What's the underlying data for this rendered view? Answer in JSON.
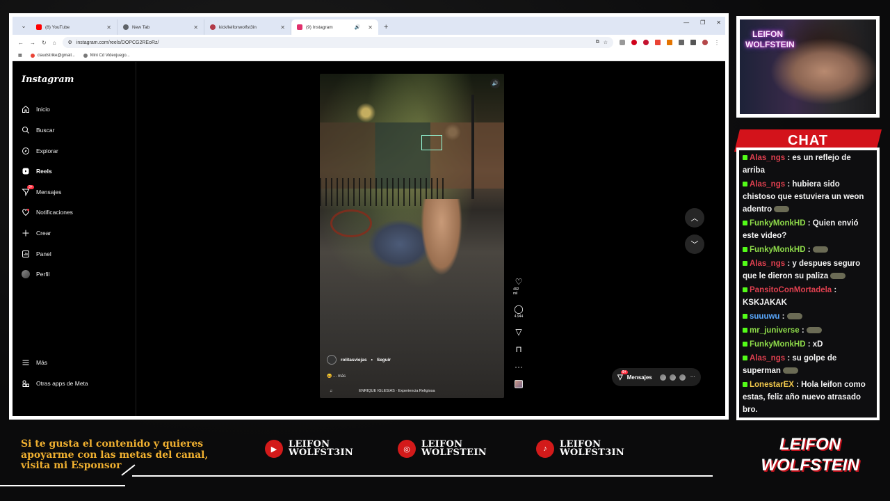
{
  "browser": {
    "tabs": [
      {
        "label": "(8) YouTube",
        "favicon_color": "#ff0000"
      },
      {
        "label": "New Tab",
        "favicon_color": "#5f6368"
      },
      {
        "label": "kick/leifonwolfst3in",
        "favicon_color": "#b23a48"
      },
      {
        "label": "(9) Instagram",
        "favicon_color": "#e1306c"
      }
    ],
    "url": "instagram.com/reels/DOPCG2REoRz/",
    "bookmarks": [
      "claudstrike@gmail...",
      "Mini Cd Videojuego..."
    ]
  },
  "instagram": {
    "logo": "Instagram",
    "nav": [
      {
        "label": "Inicio",
        "icon": "home-icon"
      },
      {
        "label": "Buscar",
        "icon": "search-icon"
      },
      {
        "label": "Explorar",
        "icon": "compass-icon"
      },
      {
        "label": "Reels",
        "icon": "reels-icon"
      },
      {
        "label": "Mensajes",
        "icon": "messenger-icon",
        "badge": "9+"
      },
      {
        "label": "Notificaciones",
        "icon": "heart-icon"
      },
      {
        "label": "Crear",
        "icon": "plus-icon"
      },
      {
        "label": "Panel",
        "icon": "dashboard-icon"
      },
      {
        "label": "Perfil",
        "icon": "avatar-icon"
      },
      {
        "label": "Más",
        "icon": "menu-icon"
      },
      {
        "label": "Otras apps de Meta",
        "icon": "meta-apps-icon"
      }
    ],
    "reel": {
      "username": "rolitasviejas",
      "follow": "Seguir",
      "caption": "😄 ... más",
      "music": "ENRIQUE IGLESIAS · Experiencia Religiosa",
      "likes": "492 mil",
      "comments": "4.944"
    },
    "messages_pill": {
      "label": "Mensajes",
      "badge": "9+"
    }
  },
  "stream": {
    "neon_sign": "LEIFON WOLFSTEIN",
    "chat_title": "CHAT",
    "chat": [
      {
        "user": "Alas_ngs",
        "color": "#e0404f",
        "text": ": es un reflejo de arriba"
      },
      {
        "user": "Alas_ngs",
        "color": "#e0404f",
        "text": ": hubiera sido chistoso que estuviera un weon adentro",
        "emote": true
      },
      {
        "user": "FunkyMonkHD",
        "color": "#8fdc4a",
        "text": ": Quien envió este video?"
      },
      {
        "user": "FunkyMonkHD",
        "color": "#8fdc4a",
        "text": ":",
        "emote": true
      },
      {
        "user": "Alas_ngs",
        "color": "#e0404f",
        "text": ": y despues seguro que le dieron su paliza",
        "emote": true
      },
      {
        "user": "PansitoConMortadela",
        "color": "#e0404f",
        "text": ": KSKJAKAK"
      },
      {
        "user": "suuuwu",
        "color": "#5aa9ff",
        "text": ":",
        "emote": true
      },
      {
        "user": "mr_juniverse",
        "color": "#8fdc4a",
        "text": ":",
        "emote": true
      },
      {
        "user": "FunkyMonkHD",
        "color": "#8fdc4a",
        "text": ": xD"
      },
      {
        "user": "Alas_ngs",
        "color": "#e0404f",
        "text": ": su golpe de superman",
        "emote": true
      },
      {
        "user": "LonestarEX",
        "color": "#f2c94c",
        "text": ": Hola leifon como estas, feliz año nuevo atrasado bro."
      }
    ],
    "support_text": "Si te gusta el contenido y quieres apoyarme con las metas del canal, visita mi Esponsor",
    "socials": [
      {
        "icon": "youtube-icon",
        "line1": "LEIFON",
        "line2": "WOLFST3IN"
      },
      {
        "icon": "instagram-icon",
        "line1": "LEIFON",
        "line2": "WOLFSTEIN"
      },
      {
        "icon": "tiktok-icon",
        "line1": "LEIFON",
        "line2": "WOLFST3IN"
      }
    ],
    "brand": "LEIFON WOLFSTEIN"
  }
}
